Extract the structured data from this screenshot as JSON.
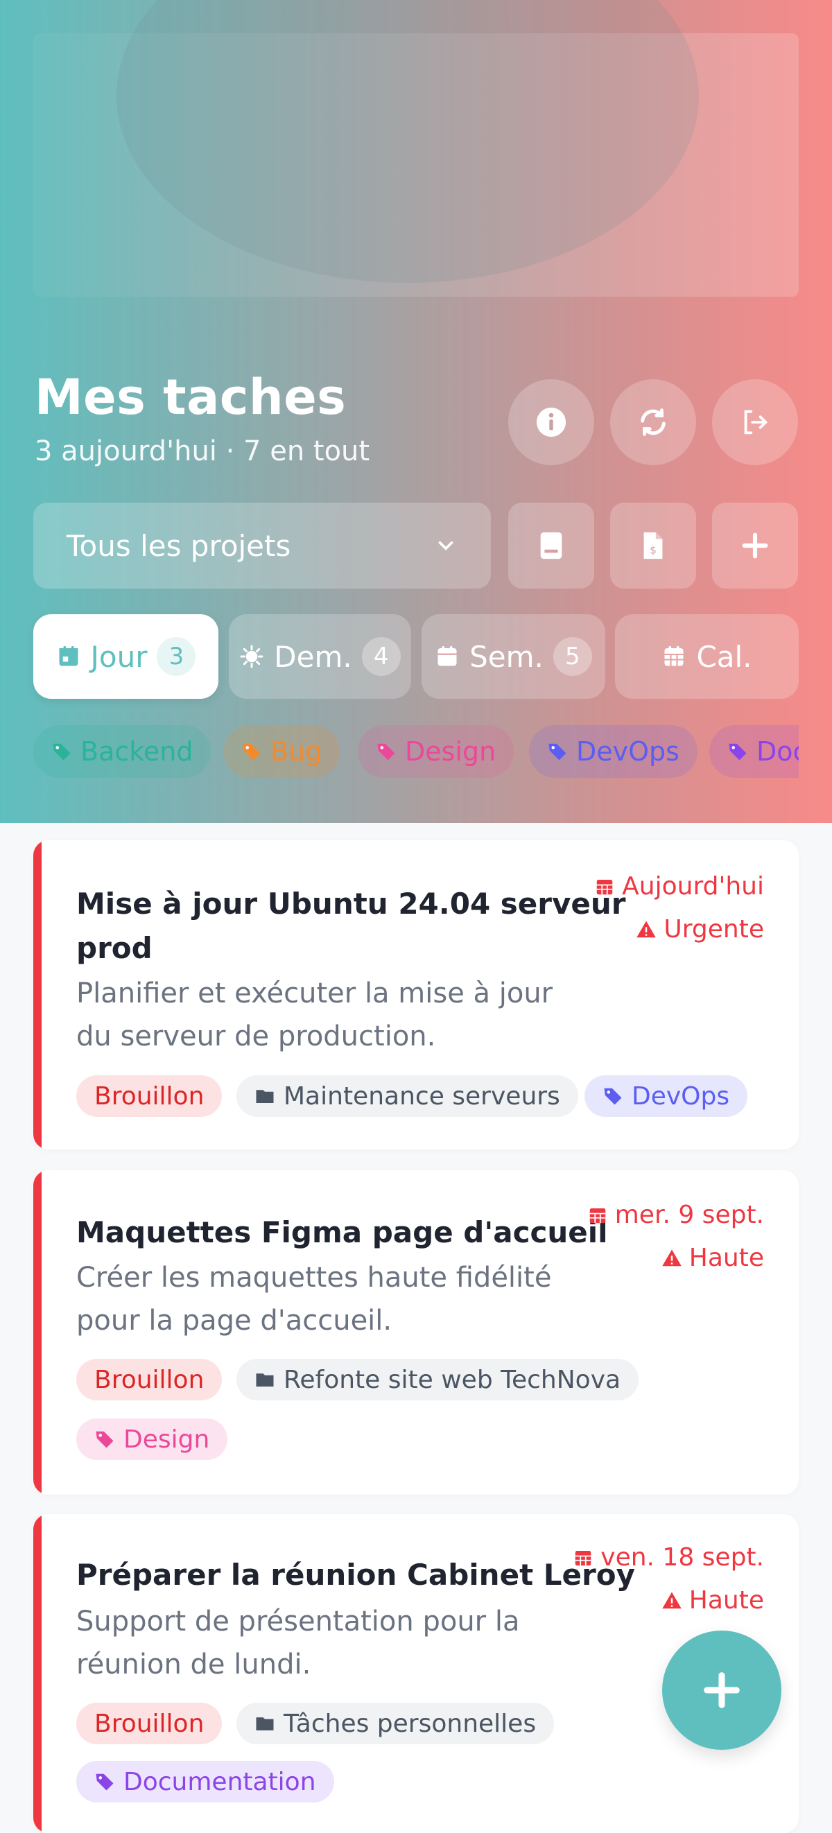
{
  "header": {
    "title": "Mes taches",
    "subtitle": "3 aujourd'hui · 7 en tout",
    "project_select": "Tous les projets",
    "icons": [
      "info-icon",
      "refresh-icon",
      "logout-icon",
      "book-icon",
      "export-file-icon",
      "plus-icon"
    ]
  },
  "tabs": [
    {
      "label": "Jour",
      "count": "3",
      "icon": "calendar-day-icon",
      "active": true
    },
    {
      "label": "Dem.",
      "count": "4",
      "icon": "sun-icon"
    },
    {
      "label": "Sem.",
      "count": "5",
      "icon": "calendar-week-icon"
    },
    {
      "label": "Cal.",
      "count": "",
      "icon": "calendar-grid-icon"
    }
  ],
  "tags": [
    {
      "label": "Backend",
      "color": "#2bb39a"
    },
    {
      "label": "Bug",
      "color": "#f28a2e"
    },
    {
      "label": "Design",
      "color": "#ec4899"
    },
    {
      "label": "DevOps",
      "color": "#5b5ef0"
    },
    {
      "label": "Documentation",
      "color": "#8b44e8"
    }
  ],
  "tasks": [
    {
      "title_line1": "Mise à jour Ubuntu 24.04 serveur",
      "title_line2": "prod",
      "desc_line1": "Planifier et exécuter la mise à jour",
      "desc_line2": "du serveur de production.",
      "date": "Aujourd'hui",
      "priority": "Urgente",
      "status": "Brouillon",
      "project": "Maintenance serveurs",
      "tag": "DevOps"
    },
    {
      "title_line1": "Maquettes Figma page d'accueil",
      "desc_line1": "Créer les maquettes haute fidélité",
      "desc_line2": "pour la page d'accueil.",
      "date": "mer. 9 sept.",
      "priority": "Haute",
      "status": "Brouillon",
      "project": "Refonte site web TechNova",
      "tag": "Design"
    },
    {
      "title_line1": "Préparer la réunion Cabinet Leroy",
      "desc_line1": "Support de présentation pour la",
      "desc_line2": "réunion de lundi.",
      "date": "ven. 18 sept.",
      "priority": "Haute",
      "status": "Brouillon",
      "project": "Tâches personnelles",
      "tag": "Documentation"
    }
  ],
  "colors": {
    "accent": "#5fbfbf",
    "danger": "#ef3742"
  }
}
